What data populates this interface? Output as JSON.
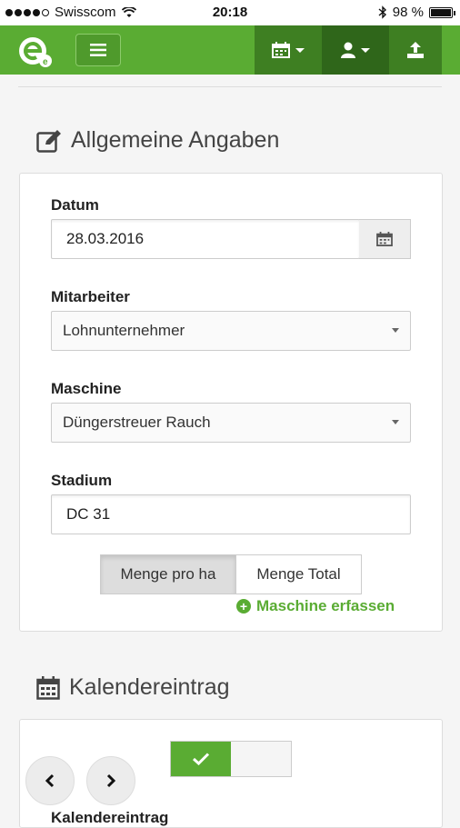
{
  "statusbar": {
    "carrier": "Swisscom",
    "time": "20:18",
    "battery": "98 %",
    "battery_level": 0.98
  },
  "navbar": {
    "logo_icon": "eagrar-logo",
    "menu_icon": "hamburger-icon",
    "calendar_icon": "calendar-icon",
    "user_icon": "user-icon",
    "upload_icon": "upload-icon",
    "accent": "#5aac33"
  },
  "general": {
    "title": "Allgemeine Angaben",
    "fields": {
      "datum_label": "Datum",
      "datum_value": "28.03.2016",
      "mitarbeiter_label": "Mitarbeiter",
      "mitarbeiter_value": "Lohnunternehmer",
      "maschine_label": "Maschine",
      "maschine_value": "Düngerstreuer Rauch",
      "stadium_label": "Stadium",
      "stadium_value": "DC 31"
    },
    "quantity_mode": {
      "per_ha": "Menge pro ha",
      "total": "Menge Total",
      "selected": "Menge pro ha"
    },
    "add_machine": "Maschine erfassen"
  },
  "calendar": {
    "title": "Kalendereintrag",
    "toggle_on": true,
    "bottom_label": "Kalendereintrag"
  }
}
